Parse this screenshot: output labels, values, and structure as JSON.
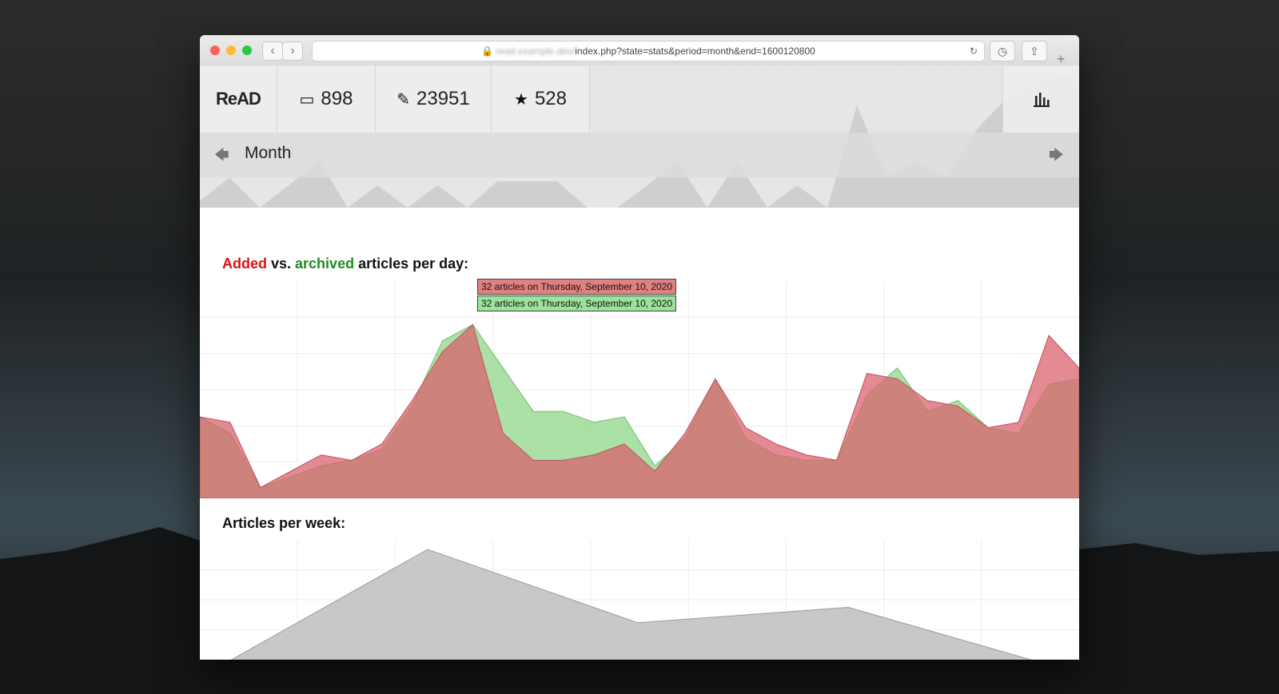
{
  "browser": {
    "url_host": "read.example.dev/",
    "url_path": "index.php?state=stats&period=month&end=1600120800"
  },
  "app": {
    "logo": "ReAD",
    "counts": [
      {
        "name": "inbox",
        "icon": "inbox-icon",
        "value": "898"
      },
      {
        "name": "archived",
        "icon": "archived-icon",
        "value": "23951"
      },
      {
        "name": "starred",
        "icon": "bookmark-star-icon",
        "value": "528"
      }
    ],
    "period_label": "Month"
  },
  "daily": {
    "title_added": "Added",
    "title_vs": " vs. ",
    "title_archived": "archived",
    "title_rest": " articles per day:",
    "tooltip_added": "32 articles on Thursday, September 10, 2020",
    "tooltip_archived": "32 articles on Thursday, September 10, 2020"
  },
  "weekly": {
    "title": "Articles per week:"
  },
  "chart_data": [
    {
      "type": "area",
      "x": [
        0,
        1,
        2,
        3,
        4,
        5,
        6,
        7,
        8,
        9,
        10,
        11,
        12,
        13,
        14,
        15,
        16,
        17,
        18,
        19,
        20,
        21,
        22,
        23,
        24,
        25,
        26,
        27,
        28,
        29
      ],
      "ylim": [
        0,
        40
      ],
      "series": [
        {
          "name": "Added",
          "color": "#d9636e",
          "values": [
            15,
            14,
            2,
            5,
            8,
            7,
            10,
            18,
            27,
            32,
            12,
            7,
            7,
            8,
            10,
            5,
            12,
            22,
            13,
            10,
            8,
            7,
            23,
            22,
            18,
            17,
            13,
            14,
            30,
            24
          ]
        },
        {
          "name": "archived",
          "color": "#8fd68a",
          "values": [
            15,
            12,
            2,
            4,
            6,
            7,
            9,
            17,
            29,
            32,
            24,
            16,
            16,
            14,
            15,
            6,
            11,
            22,
            11,
            8,
            7,
            7,
            19,
            24,
            16,
            18,
            13,
            12,
            21,
            22
          ]
        }
      ]
    },
    {
      "type": "area",
      "x": [
        0,
        1,
        2,
        3,
        4
      ],
      "ylim": [
        0,
        1
      ],
      "series": [
        {
          "name": "",
          "color": "#c8c8c8",
          "values": [
            0,
            1,
            0.38,
            0.51,
            0
          ]
        }
      ]
    }
  ],
  "colors": {
    "added": "#d9636e",
    "archived": "#8fd68a",
    "overlap": "#8e8f63",
    "grey": "#c6c6c6"
  }
}
